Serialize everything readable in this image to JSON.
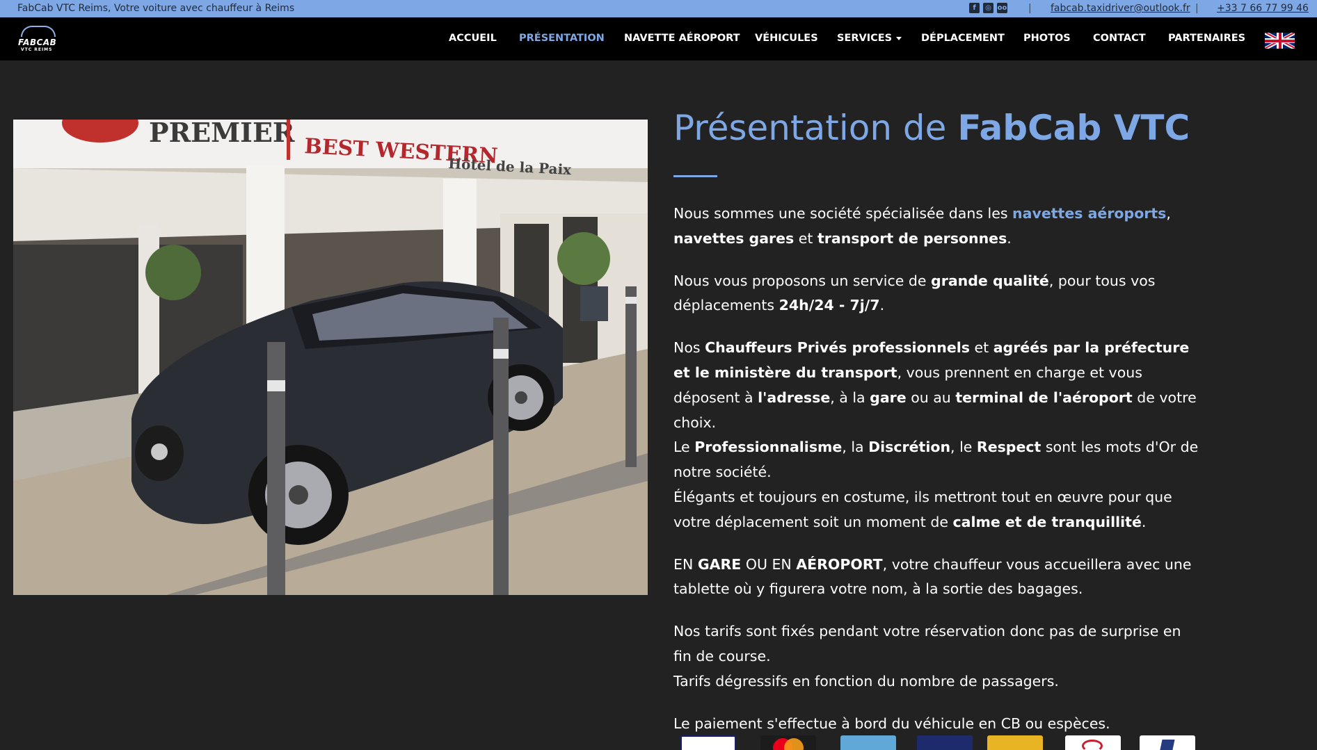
{
  "topbar": {
    "tagline": "FabCab VTC Reims, Votre voiture avec chauffeur à Reims",
    "email": "fabcab.taxidriver@outlook.fr",
    "phone": "+33 7 66 77 99 46",
    "separator": "|",
    "social_icons": [
      "facebook-icon",
      "instagram-icon",
      "tripadvisor-icon"
    ]
  },
  "logo": {
    "name": "FABCAB",
    "sub": "VTC REIMS"
  },
  "nav": {
    "items": [
      {
        "label": "ACCUEIL"
      },
      {
        "label": "PRÉSENTATION",
        "active": true
      },
      {
        "label": "NAVETTE AÉROPORT"
      },
      {
        "label": "VÉHICULES"
      },
      {
        "label": "SERVICES"
      },
      {
        "label": "DÉPLACEMENT"
      },
      {
        "label": "PHOTOS"
      },
      {
        "label": "CONTACT"
      },
      {
        "label": "PARTENAIRES"
      }
    ],
    "language_flag": "uk-flag-icon"
  },
  "photo": {
    "signs": [
      "PREMIER",
      "BEST WESTERN",
      "Hôtel de la Paix"
    ]
  },
  "main": {
    "title_prefix": "Présentation de ",
    "title_brand": "FabCab VTC",
    "p1": {
      "t1": "Nous sommes une société spécialisée dans les ",
      "link": "navettes aéroports",
      "t2": ",",
      "b1": "navettes gares",
      "t3": " et ",
      "b2": "transport de personnes",
      "t4": "."
    },
    "p2": {
      "t1": "Nous vous proposons un service de ",
      "b1": "grande qualité",
      "t2": ", pour tous vos déplacements ",
      "b2": "24h/24 - 7j/7",
      "t3": "."
    },
    "p3": {
      "t1": "Nos ",
      "b1": "Chauffeurs Privés professionnels",
      "t2": " et ",
      "b2": "agréés par la préfecture et le ministère du transport",
      "t3": ", vous prennent en charge et vous déposent à ",
      "b3": "l'adresse",
      "t4": ", à la ",
      "b4": "gare",
      "t5": " ou au ",
      "b5": "terminal de l'aéroport",
      "t6": " de votre choix.",
      "t7": "Le ",
      "b6": "Professionnalisme",
      "t8": ", la ",
      "b7": "Discrétion",
      "t9": ", le ",
      "b8": "Respect",
      "t10": " sont les mots d'Or de notre société.",
      "t11": "Élégants et toujours en costume, ils mettront tout en œuvre pour que votre déplacement soit un moment de ",
      "b9": "calme et de tranquillité",
      "t12": "."
    },
    "p4": {
      "t1": "EN ",
      "b1": "GARE",
      "t2": " OU EN ",
      "b2": "AÉROPORT",
      "t3": ", votre chauffeur vous accueillera avec une tablette où y figurera votre nom, à la sortie des bagages."
    },
    "p5": {
      "t1": "Nos tarifs sont fixés pendant votre réservation donc pas de surprise en fin de course.",
      "t2": "Tarifs dégressifs en fonction du nombre de passagers."
    },
    "p6": "Le paiement s'effectue à bord du véhicule en CB ou espèces."
  },
  "payments": [
    "visa-icon",
    "mastercard-icon",
    "amex-icon",
    "cb-icon",
    "cheque-icon",
    "ancv-icon",
    "paypal-icon"
  ],
  "colors": {
    "accent": "#7ea7e6",
    "background": "#222222",
    "nav": "#000000"
  }
}
